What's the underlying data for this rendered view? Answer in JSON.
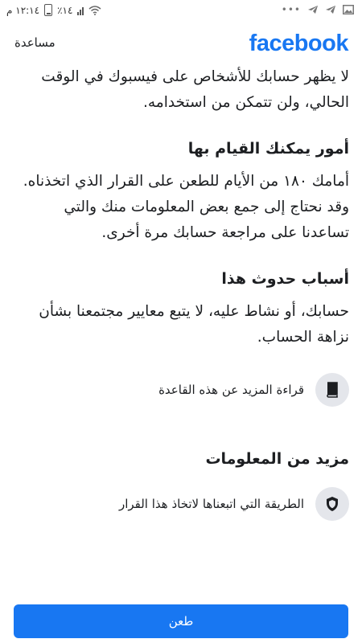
{
  "status_bar": {
    "time": "١٢:١٤ م",
    "battery": "٪١٤"
  },
  "header": {
    "logo": "facebook",
    "help": "مساعدة"
  },
  "intro": "لا يظهر حسابك للأشخاص على فيسبوك في الوقت الحالي، ولن تتمكن من استخدامه.",
  "sections": {
    "what_you_can_do": {
      "title": "أمور يمكنك القيام بها",
      "body": "أمامك ١٨٠ من الأيام للطعن على القرار الذي اتخذناه. وقد نحتاج إلى جمع بعض المعلومات منك والتي تساعدنا على مراجعة حسابك مرة أخرى."
    },
    "why": {
      "title": "أسباب حدوث هذا",
      "body": "حسابك، أو نشاط عليه، لا يتبع معايير مجتمعنا بشأن نزاهة الحساب.",
      "link": "قراءة المزيد عن هذه القاعدة",
      "link_icon": "book-icon"
    },
    "more_info": {
      "title": "مزيد من المعلومات",
      "link": "الطريقة التي اتبعناها لاتخاذ هذا القرار",
      "link_icon": "shield-icon"
    }
  },
  "appeal_button": "طعن",
  "colors": {
    "brand": "#1877f2",
    "icon_bg": "#e4e6eb",
    "text": "#1c1e21"
  }
}
